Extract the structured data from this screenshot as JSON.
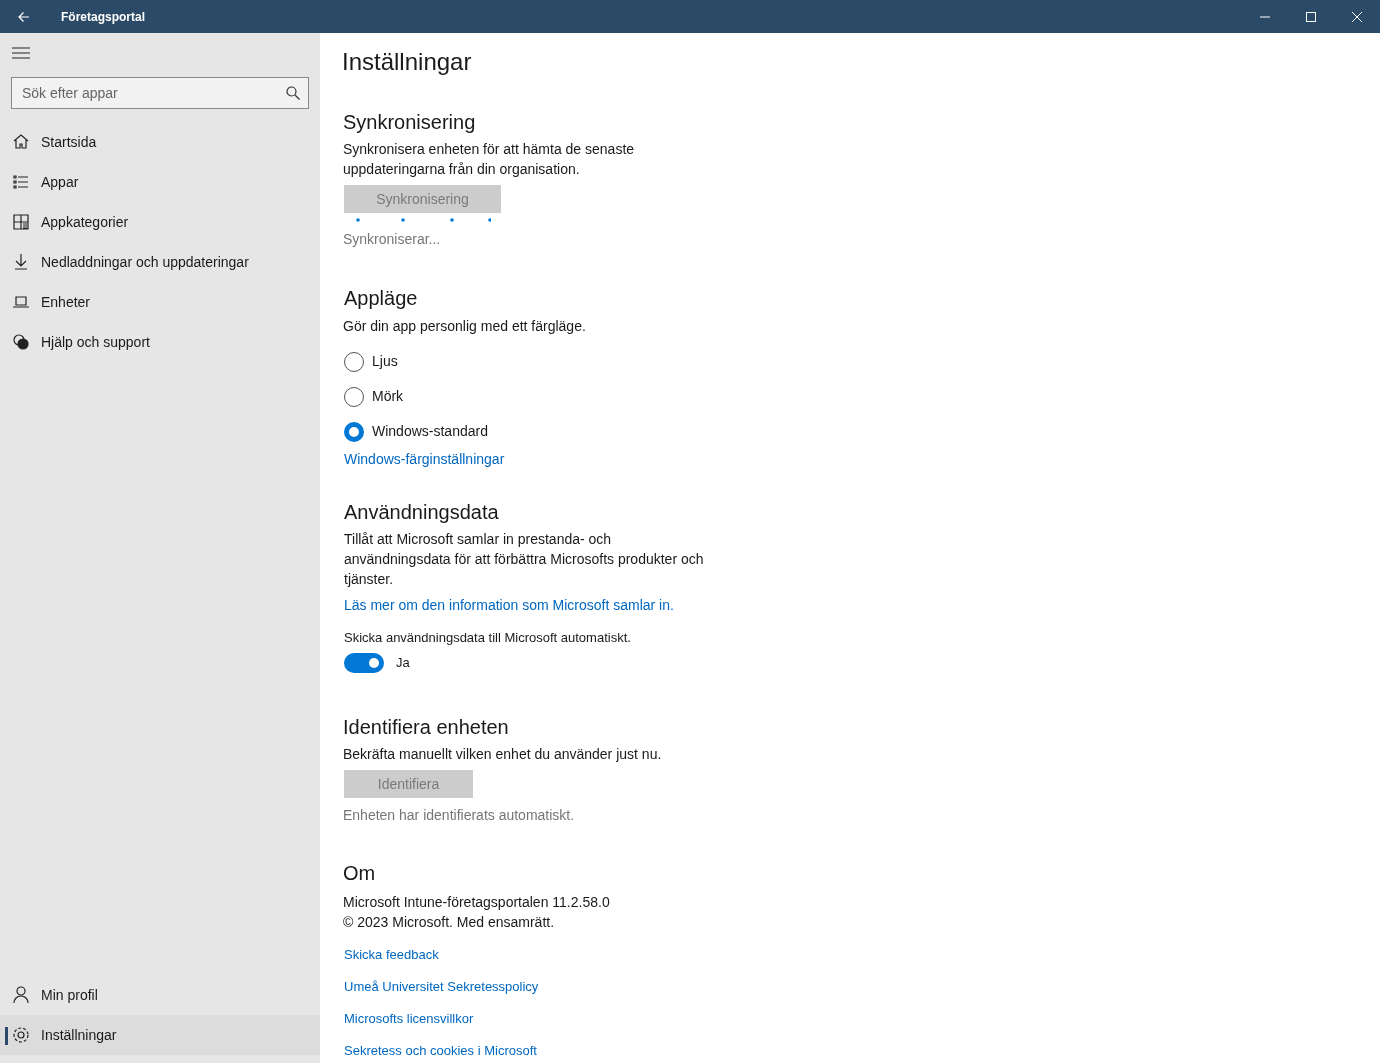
{
  "window": {
    "title": "Företagsportal"
  },
  "sidebar": {
    "search": {
      "placeholder": "Sök efter appar"
    },
    "items": [
      {
        "label": "Startsida",
        "selected": false
      },
      {
        "label": "Appar",
        "selected": false
      },
      {
        "label": "Appkategorier",
        "selected": false
      },
      {
        "label": "Nedladdningar och uppdateringar",
        "selected": false
      },
      {
        "label": "Enheter",
        "selected": false
      },
      {
        "label": "Hjälp och support",
        "selected": false
      }
    ],
    "bottom_items": [
      {
        "label": "Min profil",
        "selected": false
      },
      {
        "label": "Inställningar",
        "selected": true
      }
    ]
  },
  "page": {
    "title": "Inställningar"
  },
  "sync": {
    "heading": "Synkronisering",
    "description": "Synkronisera enheten för att hämta de senaste uppdateringarna från din organisation.",
    "button": {
      "label": "Synkronisering",
      "disabled": true
    },
    "status": "Synkroniserar..."
  },
  "app_mode": {
    "heading": "Appläge",
    "description": "Gör din app personlig med ett färgläge.",
    "options": [
      {
        "label": "Ljus",
        "selected": false
      },
      {
        "label": "Mörk",
        "selected": false
      },
      {
        "label": "Windows-standard",
        "selected": true
      }
    ],
    "link": "Windows-färginställningar"
  },
  "usage": {
    "heading": "Användningsdata",
    "description": "Tillåt att Microsoft samlar in prestanda- och användningsdata för att förbättra Microsofts produkter och tjänster.",
    "link": "Läs mer om den information som Microsoft samlar in.",
    "toggle_label": "Skicka användningsdata till Microsoft automatiskt.",
    "toggle": {
      "on": true,
      "label": "Ja"
    }
  },
  "identify": {
    "heading": "Identifiera enheten",
    "description": "Bekräfta manuellt vilken enhet du använder just nu.",
    "button": {
      "label": "Identifiera",
      "disabled": true
    },
    "status": "Enheten har identifierats automatiskt."
  },
  "about": {
    "heading": "Om",
    "lines": [
      "Microsoft Intune-företagsportalen 11.2.58.0",
      "© 2023 Microsoft. Med ensamrätt."
    ],
    "links": [
      "Skicka feedback",
      "Umeå Universitet Sekretesspolicy",
      "Microsofts licensvillkor",
      "Sekretess och cookies i Microsoft"
    ]
  }
}
